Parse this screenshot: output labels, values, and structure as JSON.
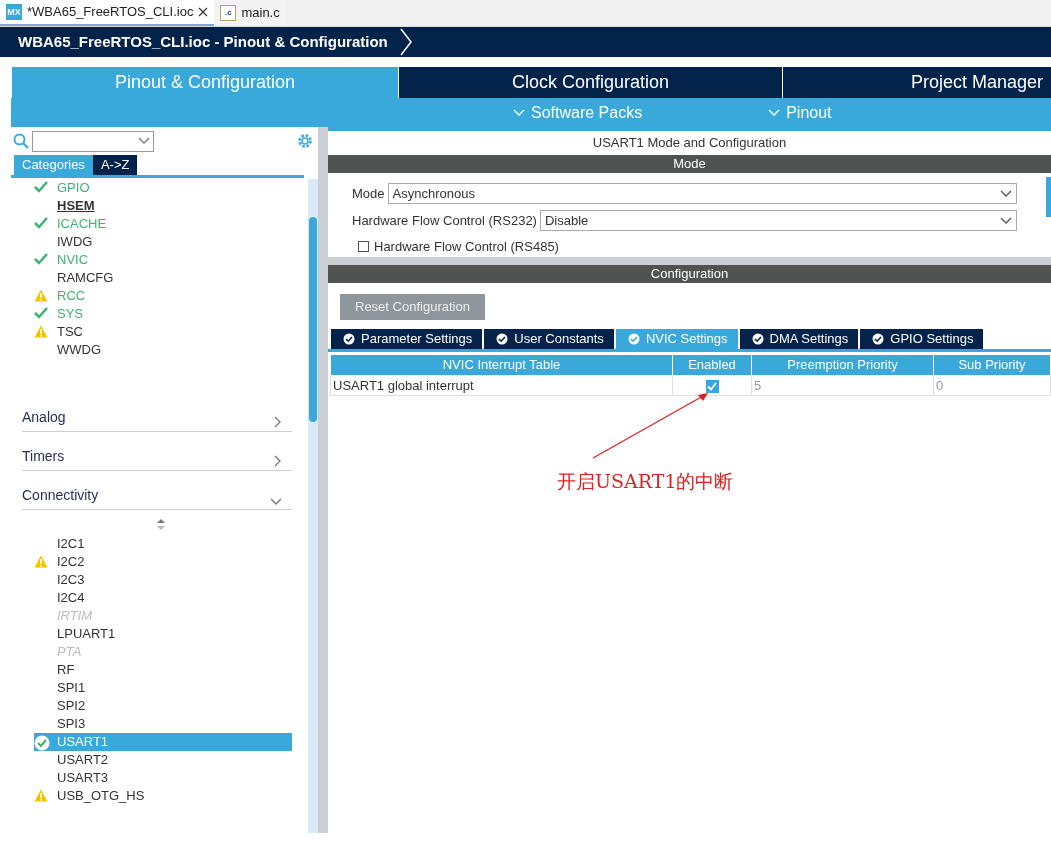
{
  "editor_tabs": [
    {
      "label": "*WBA65_FreeRTOS_CLI.ioc",
      "kind": "ioc",
      "badge": "MX",
      "selected": true,
      "closable": true
    },
    {
      "label": "main.c",
      "kind": "source",
      "badge": ".c",
      "selected": false,
      "closable": false
    }
  ],
  "breadcrumb": "WBA65_FreeRTOS_CLI.ioc - Pinout & Configuration",
  "main_tabs": [
    {
      "label": "Pinout & Configuration",
      "selected": true
    },
    {
      "label": "Clock Configuration",
      "selected": false
    },
    {
      "label": "Project Manager",
      "selected": false
    }
  ],
  "sub_menus": [
    "Software Packs",
    "Pinout"
  ],
  "sidebar": {
    "view_tabs": [
      {
        "label": "Categories",
        "selected": true
      },
      {
        "label": "A->Z",
        "selected": false
      }
    ],
    "system_items": [
      {
        "label": "GPIO",
        "ok": true,
        "warning": false,
        "kind": "configured"
      },
      {
        "label": "HSEM",
        "ok": false,
        "warning": false,
        "kind": "hovered"
      },
      {
        "label": "ICACHE",
        "ok": true,
        "warning": false,
        "kind": "configured"
      },
      {
        "label": "IWDG",
        "ok": false,
        "warning": false,
        "kind": "plain"
      },
      {
        "label": "NVIC",
        "ok": true,
        "warning": false,
        "kind": "configured"
      },
      {
        "label": "RAMCFG",
        "ok": false,
        "warning": false,
        "kind": "plain"
      },
      {
        "label": "RCC",
        "ok": false,
        "warning": true,
        "kind": "configured"
      },
      {
        "label": "SYS",
        "ok": true,
        "warning": false,
        "kind": "configured"
      },
      {
        "label": "TSC",
        "ok": false,
        "warning": true,
        "kind": "plain"
      },
      {
        "label": "WWDG",
        "ok": false,
        "warning": false,
        "kind": "plain"
      }
    ],
    "categories": [
      {
        "label": "Analog",
        "expanded": false
      },
      {
        "label": "Timers",
        "expanded": false
      },
      {
        "label": "Connectivity",
        "expanded": true
      }
    ],
    "connectivity_items": [
      {
        "label": "I2C1",
        "ok": false,
        "warning": false,
        "kind": "plain",
        "selected": false
      },
      {
        "label": "I2C2",
        "ok": false,
        "warning": true,
        "kind": "plain",
        "selected": false
      },
      {
        "label": "I2C3",
        "ok": false,
        "warning": false,
        "kind": "plain",
        "selected": false
      },
      {
        "label": "I2C4",
        "ok": false,
        "warning": false,
        "kind": "plain",
        "selected": false
      },
      {
        "label": "IRTIM",
        "ok": false,
        "warning": false,
        "kind": "unavailable",
        "selected": false
      },
      {
        "label": "LPUART1",
        "ok": false,
        "warning": false,
        "kind": "plain",
        "selected": false
      },
      {
        "label": "PTA",
        "ok": false,
        "warning": false,
        "kind": "unavailable",
        "selected": false
      },
      {
        "label": "RF",
        "ok": false,
        "warning": false,
        "kind": "plain",
        "selected": false
      },
      {
        "label": "SPI1",
        "ok": false,
        "warning": false,
        "kind": "plain",
        "selected": false
      },
      {
        "label": "SPI2",
        "ok": false,
        "warning": false,
        "kind": "plain",
        "selected": false
      },
      {
        "label": "SPI3",
        "ok": false,
        "warning": false,
        "kind": "plain",
        "selected": false
      },
      {
        "label": "USART1",
        "ok": true,
        "warning": false,
        "kind": "plain",
        "selected": true
      },
      {
        "label": "USART2",
        "ok": false,
        "warning": false,
        "kind": "plain",
        "selected": false
      },
      {
        "label": "USART3",
        "ok": false,
        "warning": false,
        "kind": "plain",
        "selected": false
      },
      {
        "label": "USB_OTG_HS",
        "ok": false,
        "warning": true,
        "kind": "plain",
        "selected": false
      }
    ]
  },
  "mode_panel": {
    "title": "USART1 Mode and Configuration",
    "header": "Mode",
    "fields": [
      {
        "label": "Mode",
        "value": "Asynchronous"
      },
      {
        "label": "Hardware Flow Control (RS232)",
        "value": "Disable"
      }
    ],
    "checkbox": {
      "label": "Hardware Flow Control (RS485)",
      "checked": false
    }
  },
  "config_panel": {
    "header": "Configuration",
    "reset_button": {
      "label": "Reset Configuration",
      "disabled": true
    },
    "tabs": [
      {
        "label": "Parameter Settings",
        "selected": false
      },
      {
        "label": "User Constants",
        "selected": false
      },
      {
        "label": "NVIC Settings",
        "selected": true
      },
      {
        "label": "DMA Settings",
        "selected": false
      },
      {
        "label": "GPIO Settings",
        "selected": false
      }
    ],
    "table": {
      "columns": [
        "NVIC Interrupt Table",
        "Enabled",
        "Preemption Priority",
        "Sub Priority"
      ],
      "rows": [
        {
          "name": "USART1 global interrupt",
          "enabled": true,
          "preemption": "5",
          "sub": "0"
        }
      ]
    }
  },
  "annotation": {
    "text": "开启USART1的中断"
  }
}
